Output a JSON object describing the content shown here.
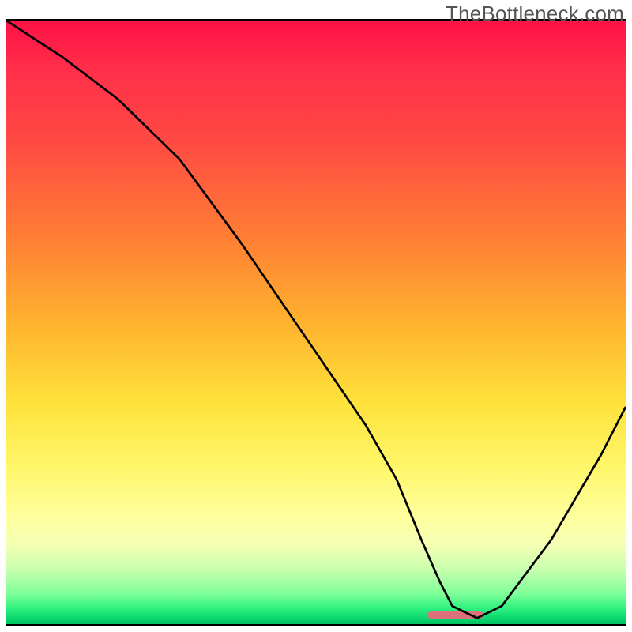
{
  "watermark": "TheBottleneck.com",
  "colors": {
    "curve": "#000000",
    "marker": "#dd717c",
    "axis": "#000000"
  },
  "chart_data": {
    "type": "line",
    "title": "",
    "xlabel": "",
    "ylabel": "",
    "xlim": [
      0,
      100
    ],
    "ylim": [
      0,
      100
    ],
    "series": [
      {
        "name": "bottleneck-curve",
        "x": [
          0,
          9,
          18,
          28,
          38,
          48,
          58,
          63,
          67,
          70,
          72,
          76,
          80,
          88,
          96,
          100
        ],
        "values": [
          100,
          94,
          87,
          77,
          63,
          48,
          33,
          24,
          14,
          7,
          3,
          1,
          3,
          14,
          28,
          36
        ]
      }
    ],
    "marker": {
      "x_start": 68,
      "x_end": 77,
      "y": 1.5,
      "height_pct": 1.2
    },
    "grid": false,
    "legend": false
  }
}
